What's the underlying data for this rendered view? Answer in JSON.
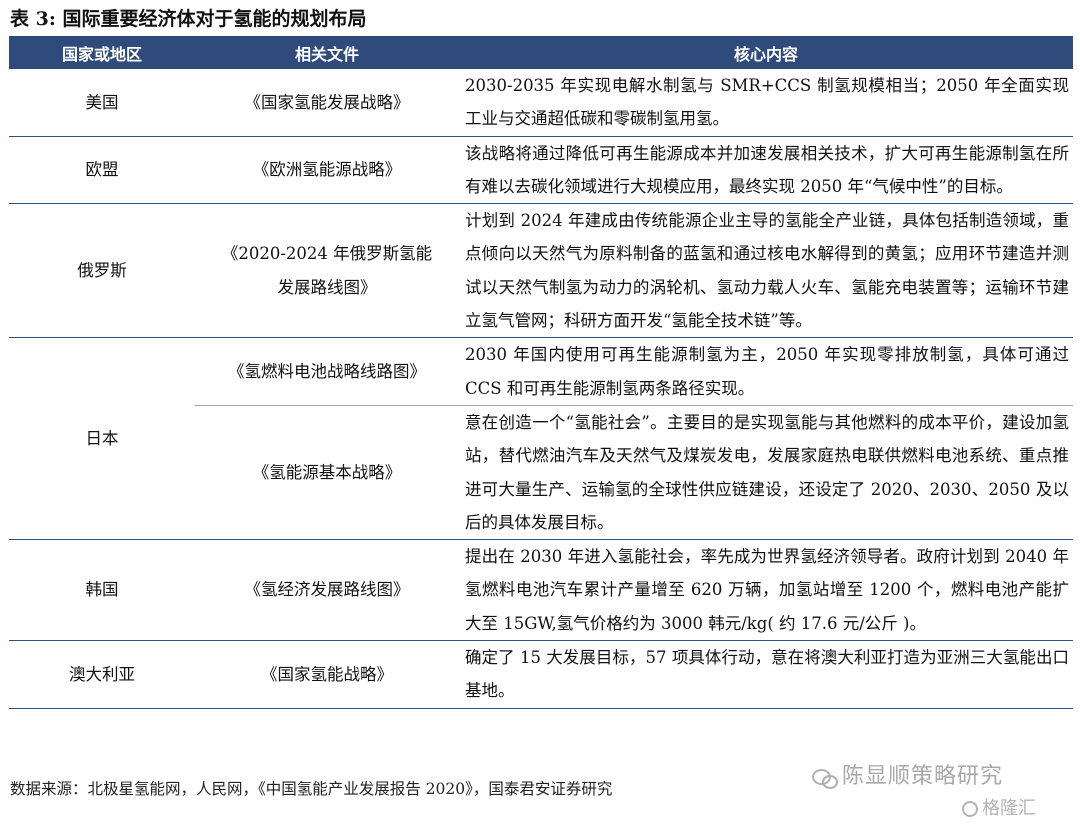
{
  "title": "表 3:  国际重要经济体对于氢能的规划布局",
  "headers": {
    "region": "国家或地区",
    "docs": "相关文件",
    "content": "核心内容"
  },
  "rows": {
    "usa": {
      "region": "美国",
      "doc": "《国家氢能发展战略》",
      "content": "2030-2035 年实现电解水制氢与 SMR+CCS 制氢规模相当；2050 年全面实现工业与交通超低碳和零碳制氢用氢。"
    },
    "eu": {
      "region": "欧盟",
      "doc": "《欧洲氢能源战略》",
      "content": "该战略将通过降低可再生能源成本并加速发展相关技术，扩大可再生能源制氢在所有难以去碳化领域进行大规模应用，最终实现 2050 年“气候中性”的目标。"
    },
    "russia": {
      "region": "俄罗斯",
      "doc": "《2020-2024 年俄罗斯氢能发展路线图》",
      "content": "计划到 2024 年建成由传统能源企业主导的氢能全产业链，具体包括制造领域，重点倾向以天然气为原料制备的蓝氢和通过核电水解得到的黄氢；应用环节建造并测试以天然气制氢为动力的涡轮机、氢动力载人火车、氢能充电装置等；运输环节建立氢气管网；科研方面开发“氢能全技术链”等。"
    },
    "japan": {
      "region": "日本",
      "doc1": "《氢燃料电池战略线路图》",
      "content1": "2030 年国内使用可再生能源制氢为主，2050 年实现零排放制氢，具体可通过 CCS 和可再生能源制氢两条路径实现。",
      "doc2": "《氢能源基本战略》",
      "content2": "意在创造一个“氢能社会”。主要目的是实现氢能与其他燃料的成本平价，建设加氢站，替代燃油汽车及天然气及煤炭发电，发展家庭热电联供燃料电池系统、重点推进可大量生产、运输氢的全球性供应链建设，还设定了 2020、2030、2050 及以后的具体发展目标。"
    },
    "korea": {
      "region": "韩国",
      "doc": "《氢经济发展路线图》",
      "content": "提出在 2030 年进入氢能社会，率先成为世界氢经济领导者。政府计划到 2040 年氢燃料电池汽车累计产量增至 620 万辆，加氢站增至 1200 个，燃料电池产能扩大至 15GW,氢气价格约为 3000 韩元/kg( 约 17.6 元/公斤 )。"
    },
    "australia": {
      "region": "澳大利亚",
      "doc": "《国家氢能战略》",
      "content": "确定了 15 大发展目标，57 项具体行动，意在将澳大利亚打造为亚洲三大氢能出口基地。"
    }
  },
  "source": "数据来源：北极星氢能网，人民网，《中国氢能产业发展报告 2020》，国泰君安证券研究",
  "watermark": "陈显顺策略研究",
  "logo": "格隆汇",
  "icons": {
    "watermark_icon": "wechat-icon",
    "logo_icon": "gelonghui-icon"
  },
  "colors": {
    "header_bg": "#2f4b7b",
    "header_text": "#ffffff",
    "rule": "#33507f"
  }
}
